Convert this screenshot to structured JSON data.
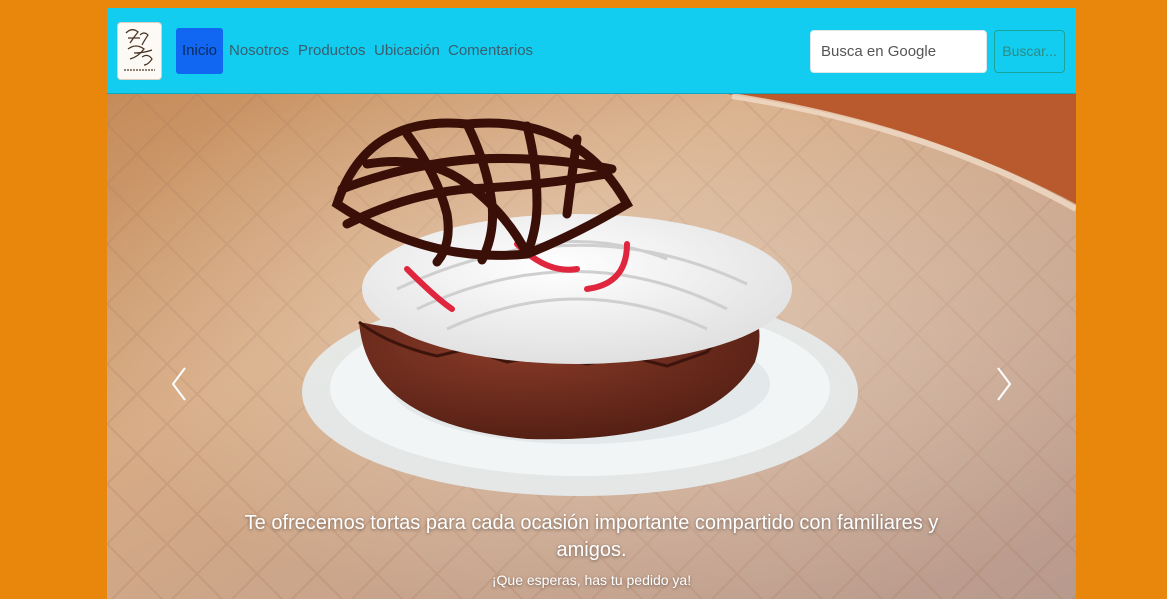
{
  "brand": {
    "logo_text": "Frank David",
    "logo_icon": "bakery-logo-icon"
  },
  "nav": {
    "items": [
      {
        "label": "Inicio",
        "active": true
      },
      {
        "label": "Nosotros",
        "active": false
      },
      {
        "label": "Productos",
        "active": false
      },
      {
        "label": "Ubicación",
        "active": false
      },
      {
        "label": "Comentarios",
        "active": false
      }
    ]
  },
  "search": {
    "placeholder": "Busca en Google",
    "value": "",
    "button_label": "Buscar..."
  },
  "carousel": {
    "prev_icon": "chevron-left-icon",
    "next_icon": "chevron-right-icon",
    "caption_title": "Te ofrecemos tortas para cada ocasión importante compartido con familiares y amigos.",
    "caption_text": "¡Que esperas, has tu pedido ya!"
  },
  "colors": {
    "page_background": "#e8870c",
    "navbar": "#12cdef",
    "active_nav": "#1167f2",
    "search_button_border": "#17a59a"
  }
}
